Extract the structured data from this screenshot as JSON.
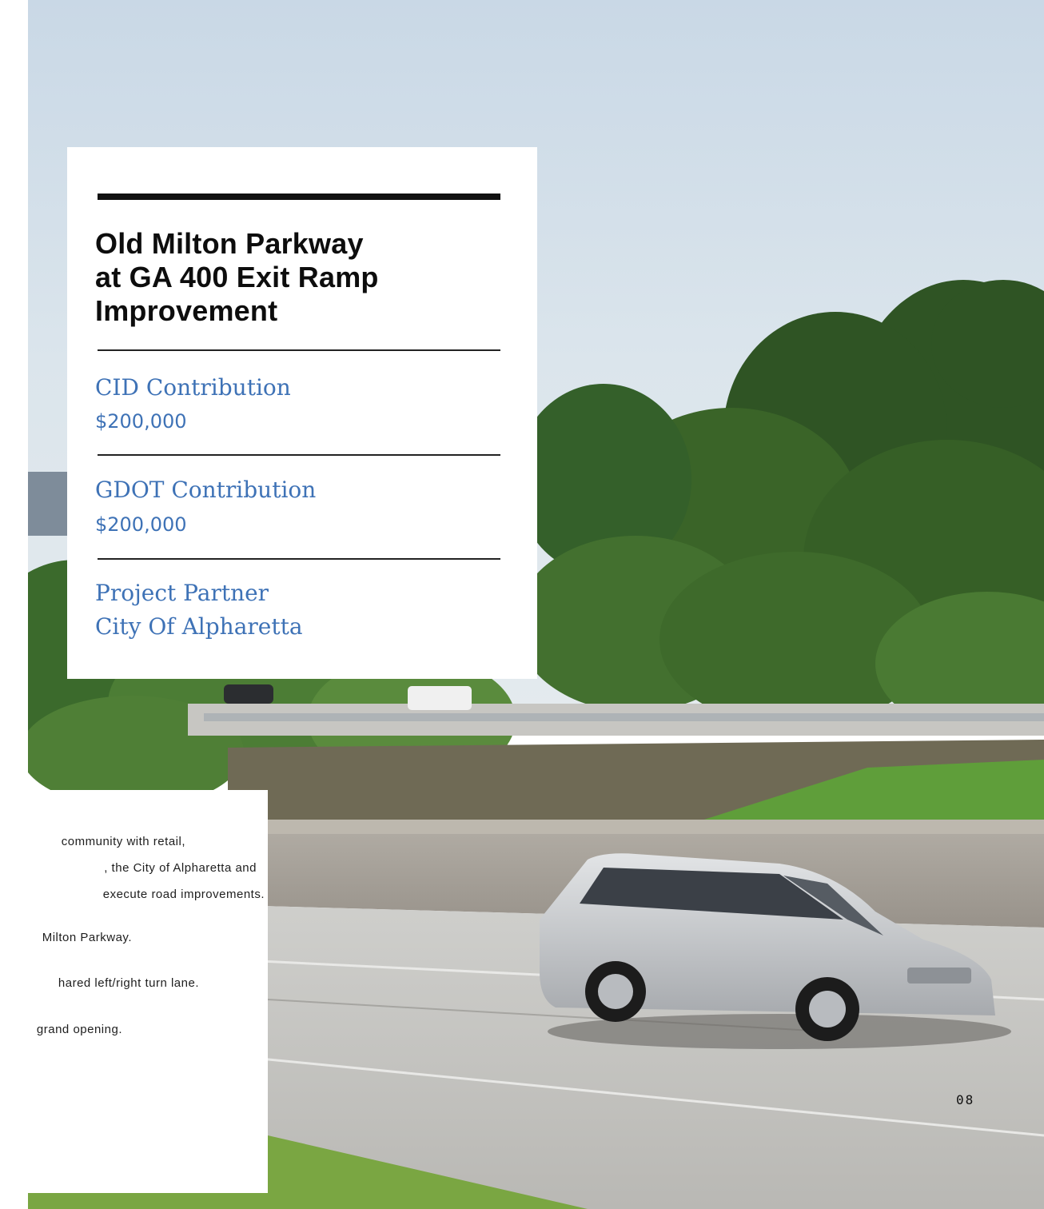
{
  "card": {
    "title_lines": [
      "Old Milton Parkway",
      "at GA 400 Exit Ramp",
      "Improvement"
    ],
    "items": [
      {
        "label": "CID Contribution",
        "value": "$200,000"
      },
      {
        "label": "GDOT Contribution",
        "value": "$200,000"
      },
      {
        "label": "Project Partner",
        "value": "City Of Alpharetta"
      }
    ]
  },
  "body_text": {
    "lines": [
      "community with retail,",
      ", the City of Alpharetta and",
      "execute road improvements.",
      "Milton Parkway.",
      "hared left/right turn lane.",
      "grand opening."
    ]
  },
  "page_number": "08",
  "colors": {
    "accent_blue": "#3e72b6",
    "title_black": "#0d0d0d"
  }
}
